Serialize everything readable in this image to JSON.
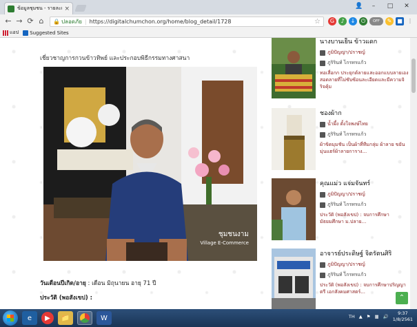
{
  "browser": {
    "tab_title": "ข้อมูลชุมชน - รายละเอียดภูมิปัญ",
    "tab_close": "×",
    "address_secure": "ปลอดภัย",
    "address_url": "https://digitalchumchon.org/home/blog_detail/1728",
    "window_min": "–",
    "window_max": "□",
    "window_close": "✕",
    "bookmarks": {
      "apps_label": "แอป",
      "suggested_label": "Suggested Sites"
    }
  },
  "article": {
    "caption": "เชี่ยวชาญการกวนข้าวทิพย์ และประกอบพิธีกรรมทางศาสนา",
    "photo_watermark_line1": "ชุมชนงาม",
    "photo_watermark_line2": "Village E-Commerce",
    "meta_label": "วันเดือนปีเกิด/อายุ",
    "meta_value": " : เดือน มิถุนายน อายุ 71 ปี",
    "history_label": "ประวัติ (พอสังเขป) :"
  },
  "sidebar": {
    "cards": [
      {
        "title": "นางบานเย็น ข้าวแดก",
        "category": "ภูมิปัญญา/ปราชญ์",
        "author": "ภูริรินท์ ไกรทรแก้ว",
        "desc": "ทอเสื่อกก ประยุกต์ลายและออกแบบลายเอง สอดลายที่ไม่ซับซ้อนละเอียดและมีความจิริจคุ้ม"
      },
      {
        "title": "ชองผ้าก",
        "category": "น้ำผึ้ง ตั้งใจพงษ์ไทย",
        "author": "ภูริรินท์ ไกรทรแก้ว",
        "desc": "ผ้าขิดมุมชัน เป็นผ้าที่ทีมกลุ่ม ผ้าลาย ขยันมุ่นแฮร์ผ้าลายการาง..."
      },
      {
        "title": "คุณแม่ว แจ่มจันทร์",
        "category": "ภูมิปัญญา/ปราชญ์",
        "author": "ภูริรินท์ ไกรทรแก้ว",
        "desc": "ประวัติ (พอสังเขป) : จบการศึกษามัธยมศึกษา ม.ปลาย..."
      },
      {
        "title": "อาจารย์ประดิษฐ์ จิตรัตนศิริ",
        "category": "ภูมิปัญญา/ปราชญ์",
        "author": "ภูริรินท์ ไกรทรแก้ว",
        "desc": "ประวัติ (พอสังเขป) : จบการศึกษาปริญญาตรี เอกสังคมศาสตร์..."
      }
    ]
  },
  "taskbar": {
    "lang": "TH",
    "time": "9:37",
    "date": "1/8/2561"
  }
}
